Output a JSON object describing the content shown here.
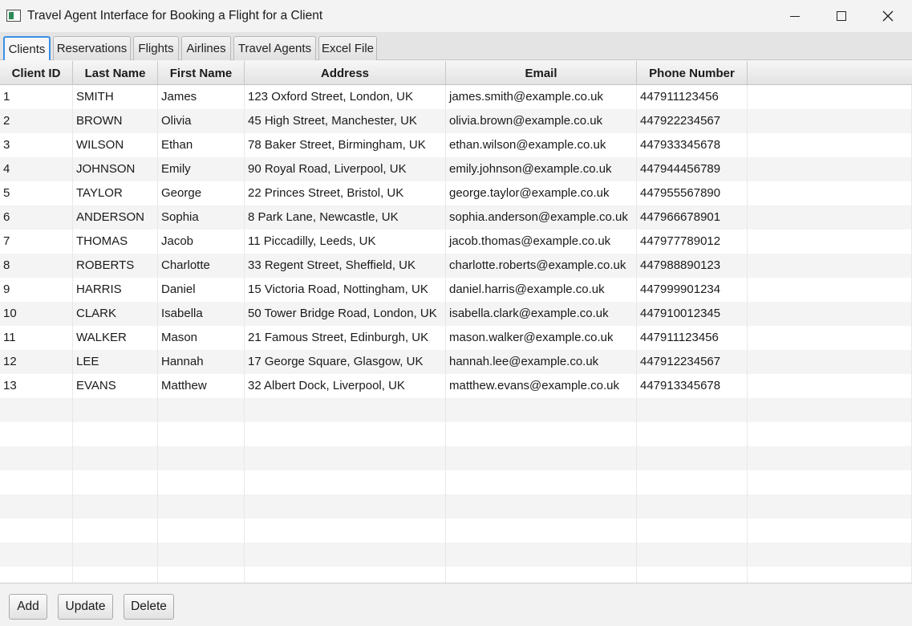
{
  "window": {
    "title": "Travel Agent Interface for Booking a Flight for a Client",
    "icon": "app-window-icon",
    "controls": [
      "minimize-icon",
      "maximize-icon",
      "close-icon"
    ]
  },
  "tabs": [
    {
      "label": "Clients",
      "selected": true
    },
    {
      "label": "Reservations",
      "selected": false
    },
    {
      "label": "Flights",
      "selected": false
    },
    {
      "label": "Airlines",
      "selected": false
    },
    {
      "label": "Travel Agents",
      "selected": false
    },
    {
      "label": "Excel File",
      "selected": false
    }
  ],
  "table": {
    "columns": [
      "Client ID",
      "Last Name",
      "First Name",
      "Address",
      "Email",
      "Phone Number"
    ],
    "rows": [
      [
        "1",
        "SMITH",
        "James",
        "123 Oxford Street, London, UK",
        "james.smith@example.co.uk",
        "447911123456"
      ],
      [
        "2",
        "BROWN",
        "Olivia",
        "45 High Street, Manchester, UK",
        "olivia.brown@example.co.uk",
        "447922234567"
      ],
      [
        "3",
        "WILSON",
        "Ethan",
        "78 Baker Street, Birmingham, UK",
        "ethan.wilson@example.co.uk",
        "447933345678"
      ],
      [
        "4",
        "JOHNSON",
        "Emily",
        "90 Royal Road, Liverpool, UK",
        "emily.johnson@example.co.uk",
        "447944456789"
      ],
      [
        "5",
        "TAYLOR",
        "George",
        "22 Princes Street, Bristol, UK",
        "george.taylor@example.co.uk",
        "447955567890"
      ],
      [
        "6",
        "ANDERSON",
        "Sophia",
        "8 Park Lane, Newcastle, UK",
        "sophia.anderson@example.co.uk",
        "447966678901"
      ],
      [
        "7",
        "THOMAS",
        "Jacob",
        "11 Piccadilly, Leeds, UK",
        "jacob.thomas@example.co.uk",
        "447977789012"
      ],
      [
        "8",
        "ROBERTS",
        "Charlotte",
        "33 Regent Street, Sheffield, UK",
        "charlotte.roberts@example.co.uk",
        "447988890123"
      ],
      [
        "9",
        "HARRIS",
        "Daniel",
        "15 Victoria Road, Nottingham, UK",
        "daniel.harris@example.co.uk",
        "447999901234"
      ],
      [
        "10",
        "CLARK",
        "Isabella",
        "50 Tower Bridge Road, London, UK",
        "isabella.clark@example.co.uk",
        "447910012345"
      ],
      [
        "11",
        "WALKER",
        "Mason",
        "21 Famous Street, Edinburgh, UK",
        "mason.walker@example.co.uk",
        "447911123456"
      ],
      [
        "12",
        "LEE",
        "Hannah",
        "17 George Square, Glasgow, UK",
        "hannah.lee@example.co.uk",
        "447912234567"
      ],
      [
        "13",
        "EVANS",
        "Matthew",
        "32 Albert Dock, Liverpool, UK",
        "matthew.evans@example.co.uk",
        "447913345678"
      ]
    ]
  },
  "actions": {
    "add_label": "Add",
    "update_label": "Update",
    "delete_label": "Delete"
  },
  "colors": {
    "selected_tab_border": "#3a8ee6",
    "row_alt": "#f4f4f4"
  }
}
